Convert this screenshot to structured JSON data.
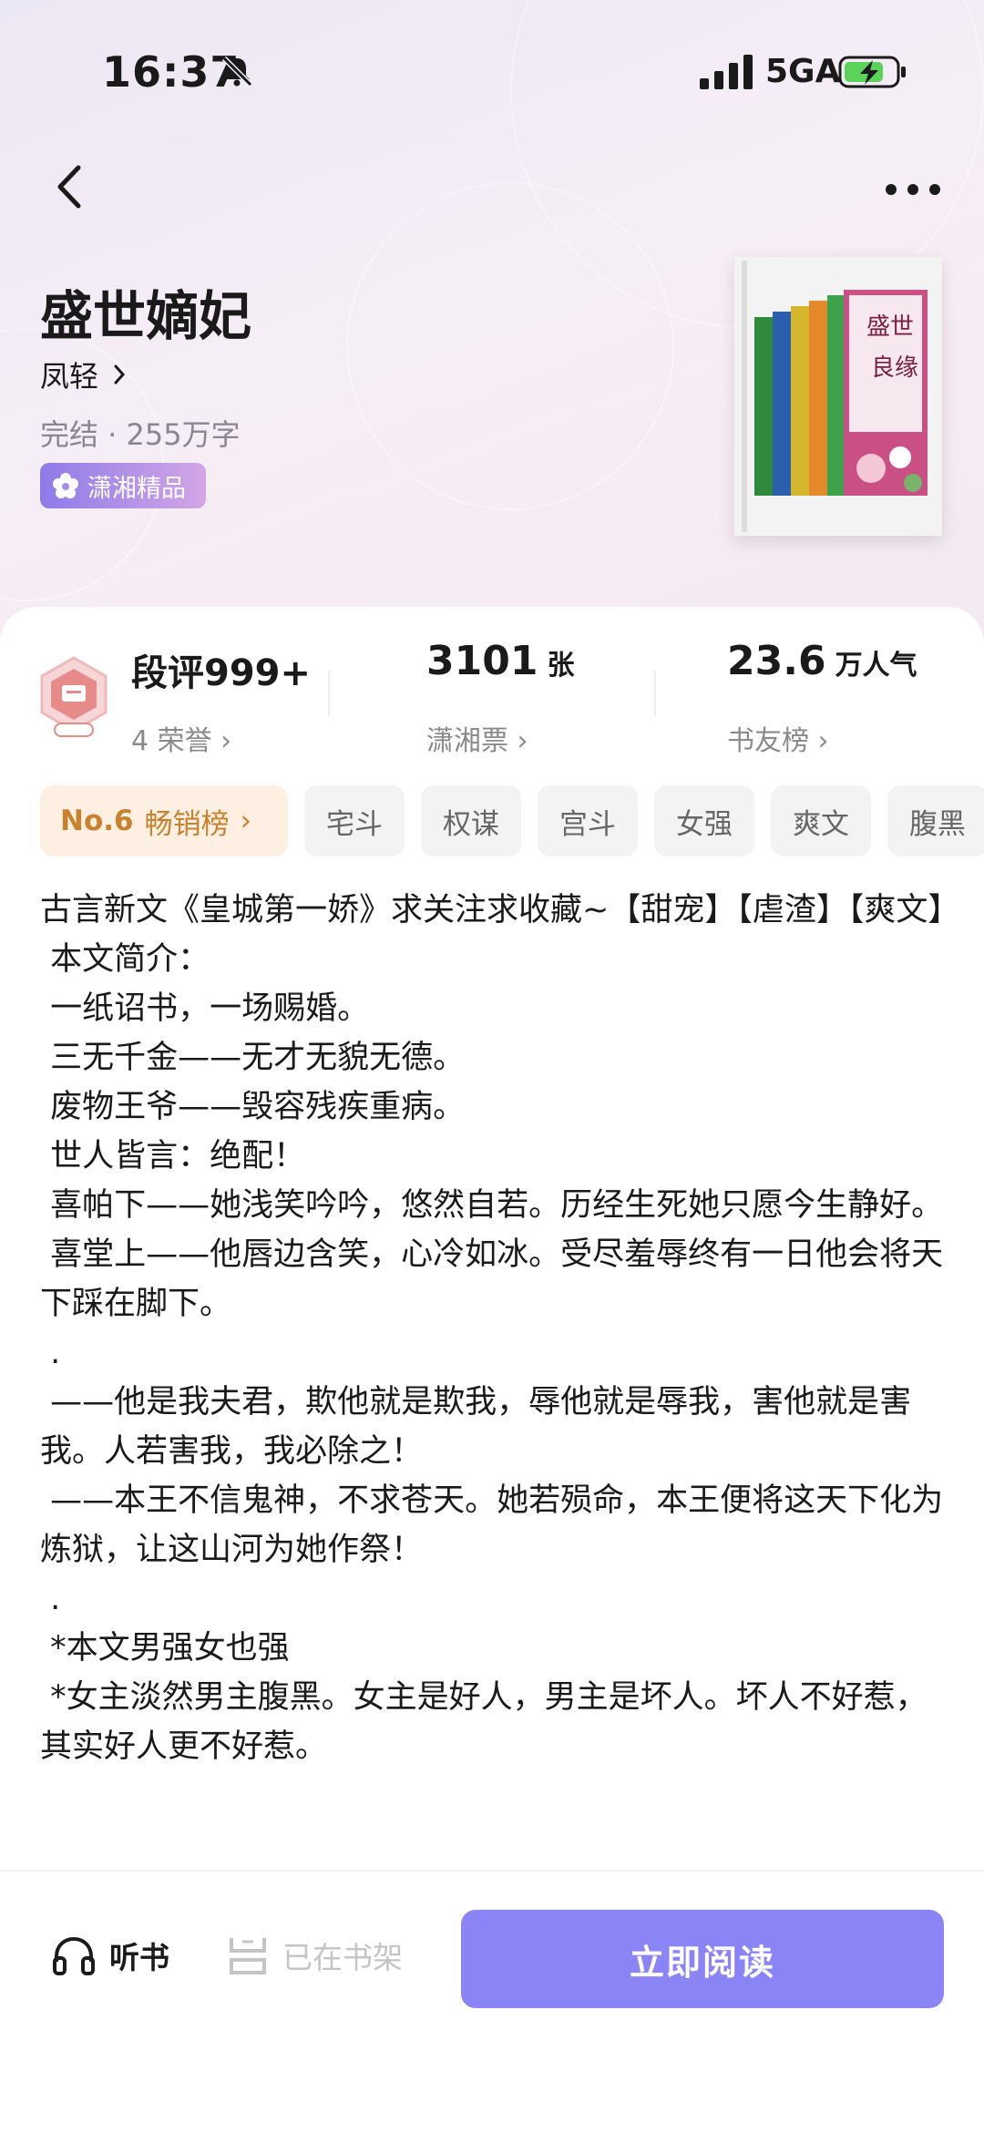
{
  "status_bar": {
    "time": "16:37",
    "network": "5GA"
  },
  "book": {
    "title": "盛世嫡妃",
    "author": "凤轻",
    "meta": "完结 · 255万字",
    "badge": "潇湘精品",
    "cover_text": "盛世良缘"
  },
  "stats": {
    "review": {
      "value": "段评999+",
      "sub": "4 荣誉"
    },
    "tickets": {
      "value": "3101",
      "unit": "张",
      "sub": "潇湘票"
    },
    "popularity": {
      "value": "23.6",
      "unit": "万人气",
      "sub": "书友榜"
    }
  },
  "rank_chip": {
    "num": "No.6",
    "label": "畅销榜"
  },
  "tags": [
    "宅斗",
    "权谋",
    "宫斗",
    "女强",
    "爽文",
    "腹黑"
  ],
  "description": [
    "古言新文《皇城第一娇》求关注求收藏~【甜宠】【虐渣】【爽文】",
    " 本文简介：",
    " 一纸诏书，一场赐婚。",
    " 三无千金——无才无貌无德。",
    " 废物王爷——毁容残疾重病。",
    " 世人皆言：绝配！",
    " 喜帕下——她浅笑吟吟，悠然自若。历经生死她只愿今生静好。",
    " 喜堂上——他唇边含笑，心冷如冰。受尽羞辱终有一日他会将天下踩在脚下。",
    " .",
    " ——他是我夫君，欺他就是欺我，辱他就是辱我，害他就是害我。人若害我，我必除之！",
    " ——本王不信鬼神，不求苍天。她若殒命，本王便将这天下化为炼狱，让这山河为她作祭！",
    " .",
    " *本文男强女也强",
    " *女主淡然男主腹黑。女主是好人，男主是坏人。坏人不好惹，其实好人更不好惹。"
  ],
  "bottom_bar": {
    "listen_label": "听书",
    "shelf_label": "已在书架",
    "read_label": "立即阅读"
  }
}
